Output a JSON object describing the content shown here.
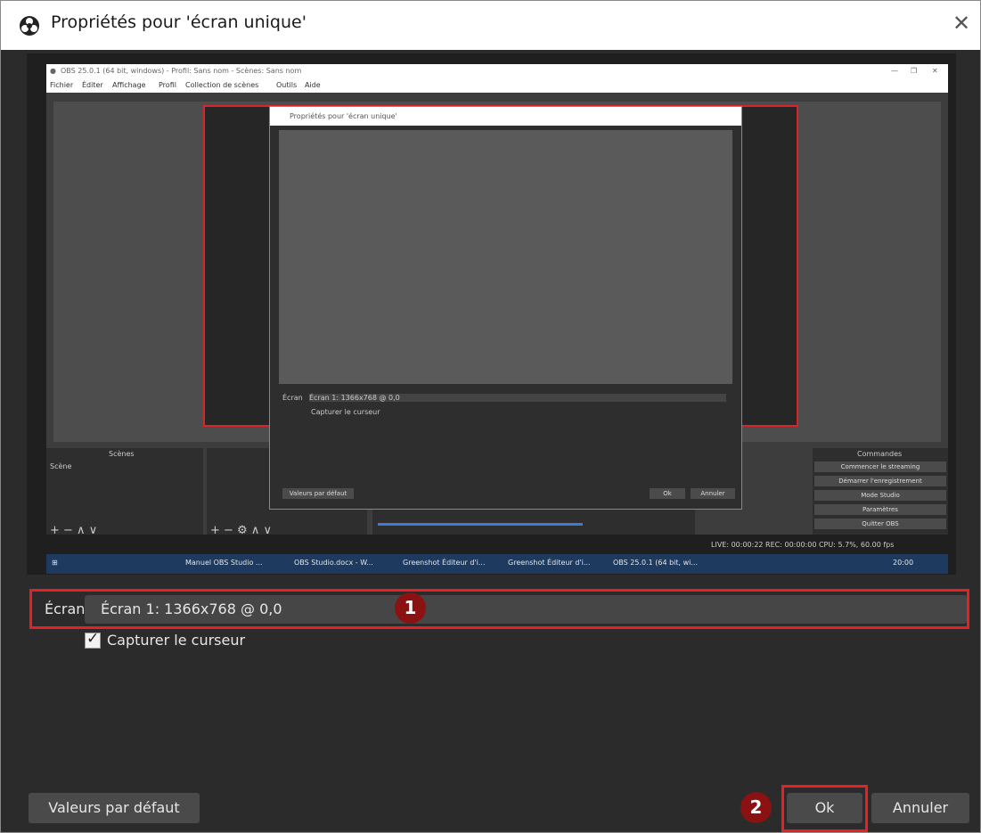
{
  "dialog": {
    "title": "Propriétés pour 'écran unique'",
    "close_icon": "close-icon",
    "logo_icon": "obs-logo-icon"
  },
  "preview": {
    "obs_window_title": "OBS 25.0.1 (64 bit, windows) - Profil: Sans nom - Scènes: Sans nom",
    "menu": [
      "Fichier",
      "Éditer",
      "Affichage",
      "Profil",
      "Collection de scènes",
      "Outils",
      "Aide"
    ],
    "inner_dialog_title": "Propriétés pour 'écran unique'",
    "inner_screen_label": "Écran",
    "inner_screen_value": "Écran 1: 1366x768 @ 0,0",
    "inner_capture_cursor": "Capturer le curseur",
    "inner_defaults": "Valeurs par défaut",
    "inner_ok": "Ok",
    "inner_cancel": "Annuler",
    "scenes_header": "Scènes",
    "scenes_item": "Scène",
    "controls_header": "Commandes",
    "controls": [
      "Commencer le streaming",
      "Démarrer l'enregistrement",
      "Mode Studio",
      "Paramètres",
      "Quitter OBS"
    ],
    "status": "LIVE: 00:00:22    REC: 00:00:00    CPU: 5.7%, 60.00 fps",
    "taskbar": [
      "Manuel OBS Studio ...",
      "OBS Studio.docx - W...",
      "Greenshot Éditeur d'i...",
      "Greenshot Éditeur d'i...",
      "OBS 25.0.1 (64 bit, wi..."
    ],
    "clock": "20:00"
  },
  "form": {
    "screen_label": "Écran",
    "screen_value": "Écran 1: 1366x768 @ 0,0",
    "capture_cursor_label": "Capturer le curseur",
    "capture_cursor_checked": true
  },
  "buttons": {
    "defaults": "Valeurs par défaut",
    "ok": "Ok",
    "cancel": "Annuler"
  },
  "annotations": {
    "badge1": "1",
    "badge2": "2",
    "highlight_color": "#e81f25",
    "badge_color": "#8b1212"
  }
}
